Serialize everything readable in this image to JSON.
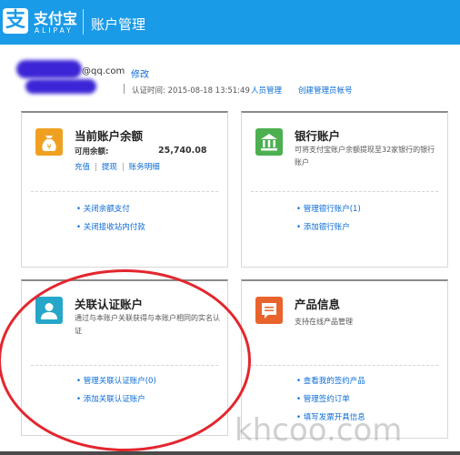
{
  "header": {
    "logo_glyph": "支",
    "logo_name": "支付宝",
    "logo_sub": "ALIPAY",
    "title": "账户管理"
  },
  "account": {
    "email_suffix": "@qq.com",
    "edit_label": "修改",
    "auth_label": "认证时间:",
    "auth_time": "2015-08-18 13:51:49",
    "link_people_manage": "人员管理",
    "link_create_admin": "创建管理员帐号"
  },
  "cards": {
    "balance": {
      "title": "当前账户余额",
      "balance_label": "可用余额:",
      "balance_value": "25,740.08",
      "actions": [
        "充值",
        "提现",
        "账务明细"
      ],
      "links": [
        "关闭余额支付",
        "关闭接收站内付款"
      ]
    },
    "bank": {
      "title": "银行账户",
      "desc": "可将支付宝账户余额提现至32家银行的银行账户",
      "links": [
        "管理银行账户(1)",
        "添加银行账户"
      ]
    },
    "linked": {
      "title": "关联认证账户",
      "desc": "通过与本账户关联获得与本账户相同的实名认证",
      "links": [
        "管理关联认证账户(0)",
        "添加关联认证账户"
      ]
    },
    "product": {
      "title": "产品信息",
      "desc": "支持在线产品管理",
      "links": [
        "查看我的签约产品",
        "管理签约订单",
        "填写发票开具信息"
      ]
    }
  },
  "watermark": "khcoo.com",
  "colors": {
    "brand_blue": "#1a9be8",
    "link_blue": "#0a6cd6",
    "balance_icon": "#f0a020",
    "bank_icon": "#4caf50",
    "linked_icon": "#26a7c9",
    "product_icon": "#e8642c",
    "annotation_red": "#e3262e"
  }
}
